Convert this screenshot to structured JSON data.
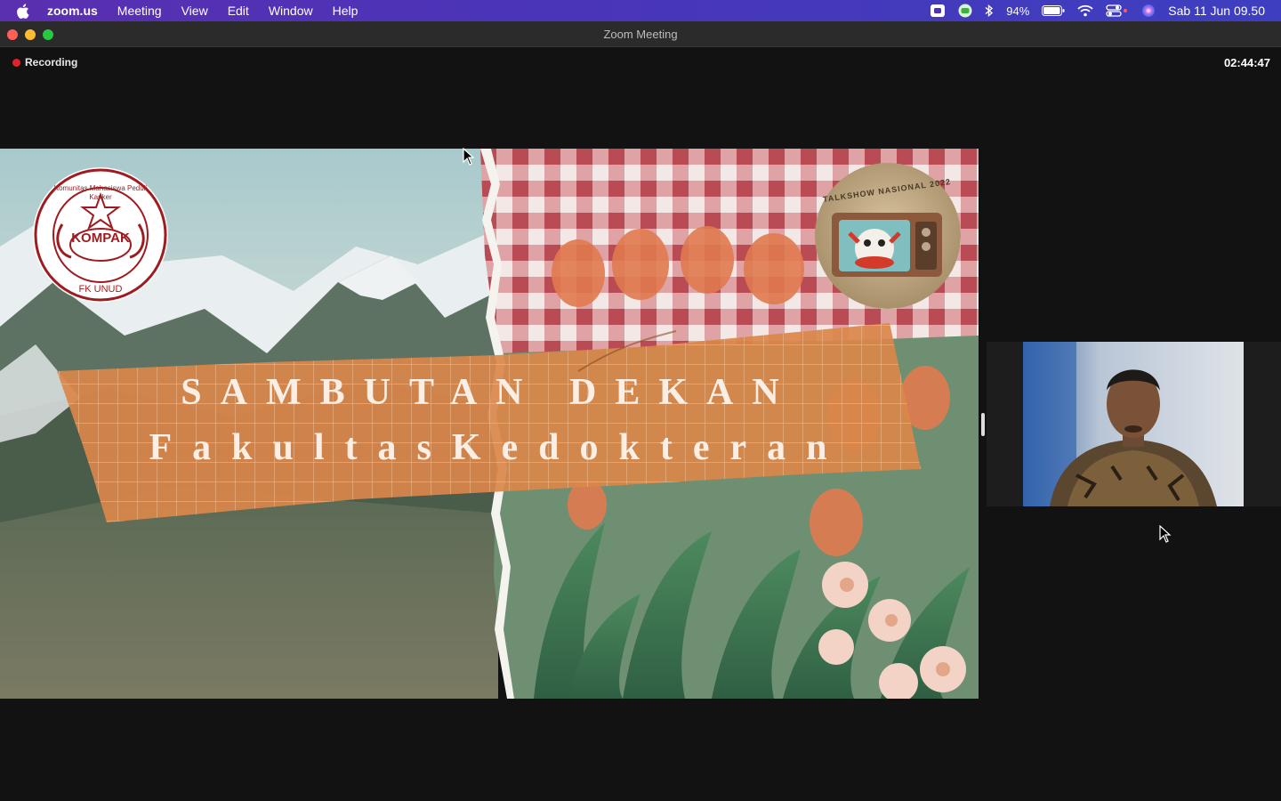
{
  "menubar": {
    "apple_icon": "apple-icon",
    "items": [
      "zoom.us",
      "Meeting",
      "View",
      "Edit",
      "Window",
      "Help"
    ],
    "battery": "94%",
    "datetime": "Sab 11 Jun  09.50"
  },
  "window": {
    "title": "Zoom Meeting",
    "recording_label": "Recording",
    "elapsed": "02:44:47"
  },
  "slide": {
    "headline": "SAMBUTAN DEKAN",
    "subheadline": "FakultasKedokteran",
    "logo_left": {
      "ring_text": "Komunitas Mahasiswa Peduli Kanker",
      "center_text": "KOMPAK",
      "bottom_text": "FK UNUD"
    },
    "logo_right": {
      "ring_text": "TALKSHOW NASIONAL 2022"
    }
  },
  "colors": {
    "accent_tape": "#d9874a",
    "recording_red": "#e0242c",
    "logo_red": "#9e1b1f"
  }
}
